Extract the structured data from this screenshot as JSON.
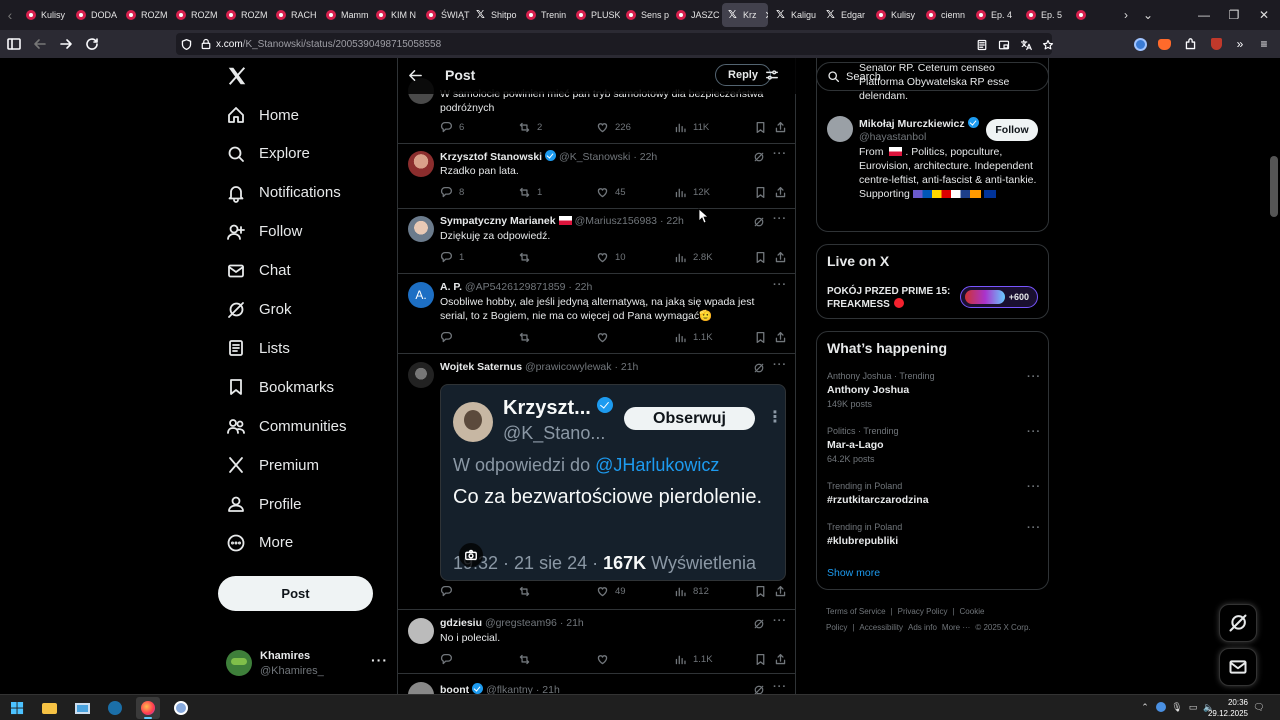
{
  "browser": {
    "tabs": [
      {
        "label": "Kulisy",
        "icon": "red-circle-favicon"
      },
      {
        "label": "DODA",
        "icon": "red-circle-favicon"
      },
      {
        "label": "ROZM",
        "icon": "red-circle-favicon"
      },
      {
        "label": "ROZM",
        "icon": "red-circle-favicon"
      },
      {
        "label": "ROZM",
        "icon": "red-circle-favicon"
      },
      {
        "label": "RACH",
        "icon": "red-circle-favicon"
      },
      {
        "label": "Mamm",
        "icon": "red-circle-favicon"
      },
      {
        "label": "KIM N",
        "icon": "red-circle-favicon"
      },
      {
        "label": "ŚWIĄT",
        "icon": "red-circle-favicon"
      },
      {
        "label": "Shitpo",
        "icon": "x-favicon"
      },
      {
        "label": "Trenin",
        "icon": "red-circle-favicon"
      },
      {
        "label": "PLUSK",
        "icon": "red-circle-favicon"
      },
      {
        "label": "Sens p",
        "icon": "red-circle-favicon"
      },
      {
        "label": "JASZC",
        "icon": "red-circle-favicon"
      },
      {
        "label": "Krz",
        "icon": "x-favicon",
        "active": true
      },
      {
        "label": "Kaligu",
        "icon": "x-favicon"
      },
      {
        "label": "Edgar",
        "icon": "x-favicon"
      },
      {
        "label": "Kulisy",
        "icon": "red-circle-favicon"
      },
      {
        "label": "ciemn",
        "icon": "red-circle-favicon"
      },
      {
        "label": "Ep. 4",
        "icon": "red-circle-favicon"
      },
      {
        "label": "Ep. 5",
        "icon": "red-circle-favicon"
      },
      {
        "label": "",
        "icon": "red-circle-favicon"
      }
    ],
    "url_host": "x.com",
    "url_path": "/K_Stanowski/status/2005390498715058558",
    "accent": "#d8204e"
  },
  "nav": {
    "items": [
      {
        "label": "Home",
        "icon": "home-icon"
      },
      {
        "label": "Explore",
        "icon": "search-icon"
      },
      {
        "label": "Notifications",
        "icon": "bell-icon"
      },
      {
        "label": "Follow",
        "icon": "add-person-icon"
      },
      {
        "label": "Chat",
        "icon": "mail-icon"
      },
      {
        "label": "Grok",
        "icon": "grok-icon"
      },
      {
        "label": "Lists",
        "icon": "list-icon"
      },
      {
        "label": "Bookmarks",
        "icon": "bookmark-icon"
      },
      {
        "label": "Communities",
        "icon": "people-icon"
      },
      {
        "label": "Premium",
        "icon": "x-logo-icon"
      },
      {
        "label": "Profile",
        "icon": "person-icon"
      },
      {
        "label": "More",
        "icon": "more-circle-icon"
      }
    ],
    "post_label": "Post",
    "account_name": "Khamires",
    "account_handle": "@Khamires_"
  },
  "header": {
    "title": "Post",
    "reply_label": "Reply"
  },
  "posts": [
    {
      "text": "W samolocie powinien mieć pan tryb samolotowy dla bezpieczeństwa podróżnych",
      "replies": "6",
      "reposts": "2",
      "likes": "226",
      "views": "11K"
    },
    {
      "name": "Krzysztof Stanowski",
      "handle": "@K_Stanowski",
      "time": "· 22h",
      "text": "Rzadko pan lata.",
      "replies": "8",
      "reposts": "1",
      "likes": "45",
      "views": "12K"
    },
    {
      "name": "Sympatyczny Marianek",
      "handle": "@Mariusz156983",
      "time": "· 22h",
      "text": "Dziękuję za odpowiedź.",
      "replies": "1",
      "reposts": "",
      "likes": "10",
      "views": "2.8K"
    },
    {
      "name": "A. P.",
      "handle": "@AP5426129871859",
      "time": "· 22h",
      "text": "Osobliwe hobby, ale jeśli jedyną alternatywą, na jaką się wpada jest serial, to z Bogiem, nie ma co więcej od Pana wymagać🫡",
      "replies": "",
      "reposts": "",
      "likes": "",
      "views": "1.1K"
    },
    {
      "name": "Wojtek Saternus",
      "handle": "@prawicowylewak",
      "time": "· 21h",
      "text": "",
      "replies": "",
      "reposts": "",
      "likes": "49",
      "views": "812"
    },
    {
      "name": "gdziesiu",
      "handle": "@gregsteam96",
      "time": "· 21h",
      "text": "No i polecial.",
      "replies": "",
      "reposts": "",
      "likes": "",
      "views": "1.1K"
    },
    {
      "name": "boont",
      "handle": "@flkantny",
      "time": "· 21h",
      "text": ""
    }
  ],
  "embed": {
    "name": "Krzyszt...",
    "handle": "@K_Stano...",
    "follow_label": "Obserwuj",
    "reply_prefix": "W odpowiedzi do",
    "reply_to": "@JHarlukowicz",
    "text": "Co za bezwartościowe pierdolenie.",
    "meta_pre": "19:32 · 21 sie 24 ·",
    "meta_views": "167K",
    "meta_post": "Wyświetlenia"
  },
  "right": {
    "search_placeholder": "Search",
    "prev_bio": "Senator RP. Ceterum censeo Platforma Obywatelska RP esse delendam.",
    "who_name": "Mikołaj Murczkiewicz",
    "who_handle": "@hayastanbol",
    "who_bio_pre": "From",
    "who_bio": ". Politics, popculture, Eurovision, architecture. Independent centre-leftist, anti-fascist & anti-tankie. Supporting",
    "follow_label": "Follow",
    "live_title": "Live on X",
    "live_text": "POKÓJ PRZED PRIME 15: FREAKMESS",
    "live_count": "+600",
    "trends_title": "What’s happening",
    "trends": [
      {
        "context": "Anthony Joshua · Trending",
        "name": "Anthony Joshua",
        "posts": "149K posts"
      },
      {
        "context": "Politics · Trending",
        "name": "Mar-a-Lago",
        "posts": "64.2K posts"
      },
      {
        "context": "Trending in Poland",
        "name": "#rzutkitarczarodzina",
        "posts": ""
      },
      {
        "context": "Trending in Poland",
        "name": "#klubrepubliki",
        "posts": ""
      }
    ],
    "show_more": "Show more",
    "footer": [
      "Terms of Service",
      "|",
      "Privacy Policy",
      "|",
      "Cookie Policy",
      "|",
      "Accessibility",
      "Ads info",
      "More ···",
      "© 2025 X Corp."
    ]
  },
  "taskbar": {
    "time": "20:36",
    "date": "29.12.2025"
  }
}
